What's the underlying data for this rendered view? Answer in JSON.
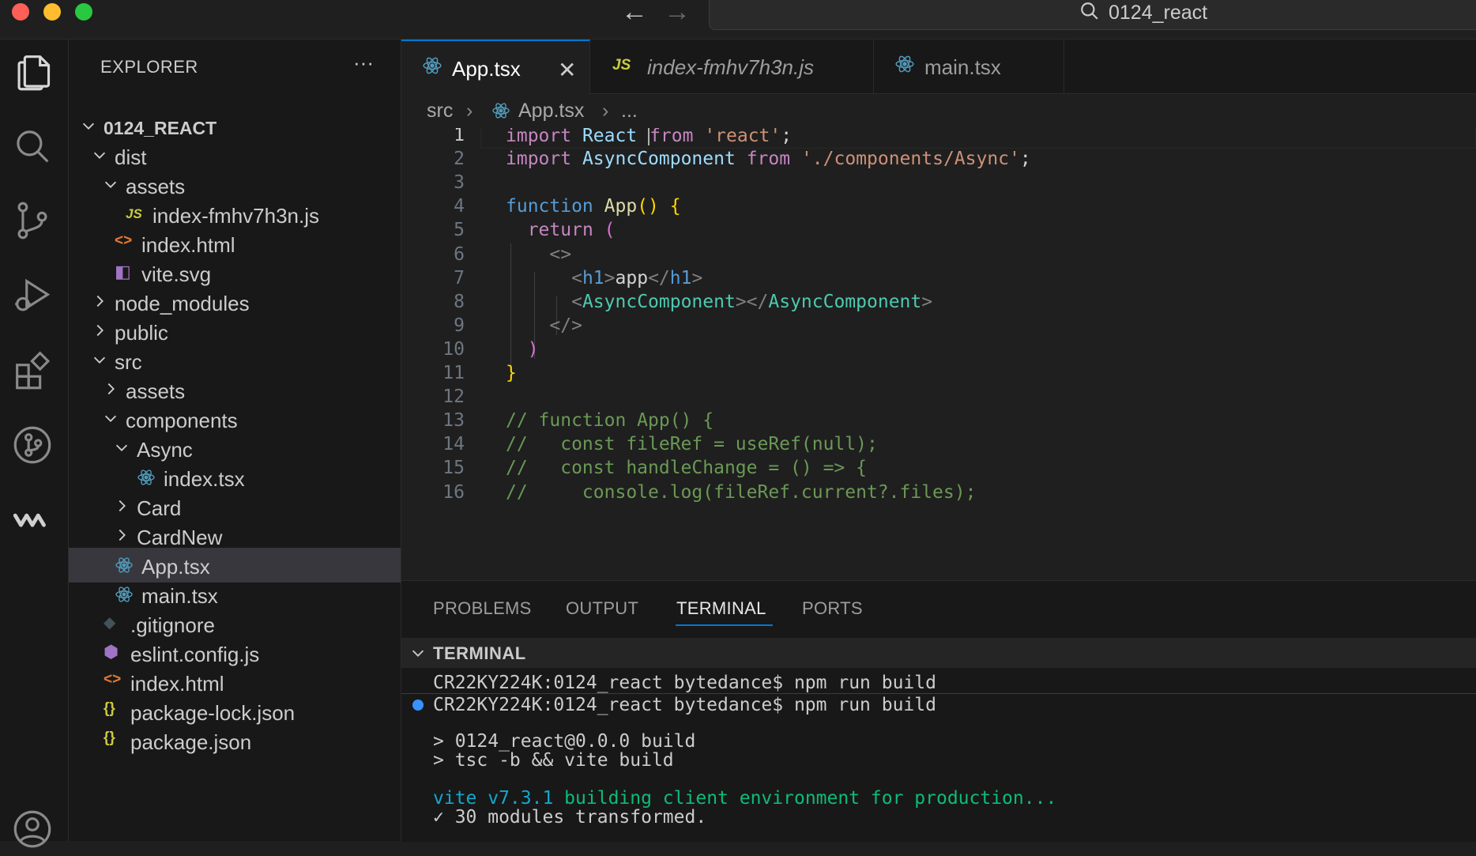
{
  "window": {
    "title": "0124_react"
  },
  "sidebar": {
    "title": "EXPLORER",
    "more": "···",
    "tree": [
      {
        "label": "0124_REACT",
        "type": "folder-open",
        "depth": 0,
        "bold": true
      },
      {
        "label": "dist",
        "type": "folder-open",
        "depth": 1
      },
      {
        "label": "assets",
        "type": "folder-open",
        "depth": 2
      },
      {
        "label": "index-fmhv7h3n.js",
        "type": "js",
        "depth": 3
      },
      {
        "label": "index.html",
        "type": "html",
        "depth": 2
      },
      {
        "label": "vite.svg",
        "type": "svg",
        "depth": 2
      },
      {
        "label": "node_modules",
        "type": "folder-closed",
        "depth": 1
      },
      {
        "label": "public",
        "type": "folder-closed",
        "depth": 1
      },
      {
        "label": "src",
        "type": "folder-open",
        "depth": 1
      },
      {
        "label": "assets",
        "type": "folder-closed",
        "depth": 2
      },
      {
        "label": "components",
        "type": "folder-open",
        "depth": 2
      },
      {
        "label": "Async",
        "type": "folder-open",
        "depth": 3
      },
      {
        "label": "index.tsx",
        "type": "react",
        "depth": 4
      },
      {
        "label": "Card",
        "type": "folder-closed",
        "depth": 3
      },
      {
        "label": "CardNew",
        "type": "folder-closed",
        "depth": 3
      },
      {
        "label": "App.tsx",
        "type": "react",
        "depth": 2,
        "selected": true
      },
      {
        "label": "main.tsx",
        "type": "react",
        "depth": 2
      },
      {
        "label": ".gitignore",
        "type": "git",
        "depth": 1
      },
      {
        "label": "eslint.config.js",
        "type": "eslint",
        "depth": 1
      },
      {
        "label": "index.html",
        "type": "html",
        "depth": 1
      },
      {
        "label": "package-lock.json",
        "type": "json",
        "depth": 1
      },
      {
        "label": "package.json",
        "type": "json",
        "depth": 1
      }
    ]
  },
  "tabs": [
    {
      "label": "App.tsx",
      "icon": "react",
      "active": true,
      "close": "✕"
    },
    {
      "label": "index-fmhv7h3n.js",
      "icon": "js",
      "italic": true
    },
    {
      "label": "main.tsx",
      "icon": "react"
    }
  ],
  "breadcrumb": {
    "folder": "src",
    "sep": "›",
    "file": "App.tsx",
    "more": "..."
  },
  "editor": {
    "active_line": 1,
    "lines": [
      {
        "n": "1",
        "tokens": [
          [
            "kw",
            "import"
          ],
          [
            "plain",
            " "
          ],
          [
            "id",
            "React"
          ],
          [
            "plain",
            " "
          ],
          [
            "cursor",
            ""
          ],
          [
            "kw",
            "from"
          ],
          [
            "plain",
            " "
          ],
          [
            "str",
            "'react'"
          ],
          [
            "plain",
            ";"
          ]
        ]
      },
      {
        "n": "2",
        "tokens": [
          [
            "kw",
            "import"
          ],
          [
            "plain",
            " "
          ],
          [
            "id",
            "AsyncComponent"
          ],
          [
            "plain",
            " "
          ],
          [
            "kw",
            "from"
          ],
          [
            "plain",
            " "
          ],
          [
            "str",
            "'./components/Async'"
          ],
          [
            "plain",
            ";"
          ]
        ]
      },
      {
        "n": "3",
        "tokens": []
      },
      {
        "n": "4",
        "tokens": [
          [
            "kw2",
            "function"
          ],
          [
            "plain",
            " "
          ],
          [
            "fn",
            "App"
          ],
          [
            "br1",
            "()"
          ],
          [
            "plain",
            " "
          ],
          [
            "br1",
            "{"
          ]
        ]
      },
      {
        "n": "5",
        "tokens": [
          [
            "plain",
            "  "
          ],
          [
            "kw",
            "return"
          ],
          [
            "plain",
            " "
          ],
          [
            "br2",
            "("
          ]
        ]
      },
      {
        "n": "6",
        "tokens": [
          [
            "plain",
            "    "
          ],
          [
            "tag",
            "<>"
          ]
        ]
      },
      {
        "n": "7",
        "tokens": [
          [
            "plain",
            "      "
          ],
          [
            "tag",
            "<"
          ],
          [
            "tname",
            "h1"
          ],
          [
            "tag",
            ">"
          ],
          [
            "plain",
            "app"
          ],
          [
            "tag",
            "</"
          ],
          [
            "tname",
            "h1"
          ],
          [
            "tag",
            ">"
          ]
        ]
      },
      {
        "n": "8",
        "tokens": [
          [
            "plain",
            "      "
          ],
          [
            "tag",
            "<"
          ],
          [
            "comp",
            "AsyncComponent"
          ],
          [
            "tag",
            "></"
          ],
          [
            "comp",
            "AsyncComponent"
          ],
          [
            "tag",
            ">"
          ]
        ]
      },
      {
        "n": "9",
        "tokens": [
          [
            "plain",
            "    "
          ],
          [
            "tag",
            "</>"
          ]
        ]
      },
      {
        "n": "10",
        "tokens": [
          [
            "plain",
            "  "
          ],
          [
            "br2",
            ")"
          ]
        ]
      },
      {
        "n": "11",
        "tokens": [
          [
            "br1",
            "}"
          ]
        ]
      },
      {
        "n": "12",
        "tokens": []
      },
      {
        "n": "13",
        "tokens": [
          [
            "cm",
            "// function App() {"
          ]
        ]
      },
      {
        "n": "14",
        "tokens": [
          [
            "cm",
            "//   const fileRef = useRef(null);"
          ]
        ]
      },
      {
        "n": "15",
        "tokens": [
          [
            "cm",
            "//   const handleChange = () => {"
          ]
        ]
      },
      {
        "n": "16",
        "tokens": [
          [
            "cm",
            "//     console.log(fileRef.current?.files);"
          ]
        ]
      }
    ]
  },
  "panel": {
    "tabs": [
      "PROBLEMS",
      "OUTPUT",
      "TERMINAL",
      "PORTS"
    ],
    "active_tab": "TERMINAL",
    "terminal_header": "TERMINAL",
    "terminal": {
      "line1": "CR22KY224K:0124_react bytedance$ npm run build",
      "line2": "CR22KY224K:0124_react bytedance$ npm run build",
      "line3": "> 0124_react@0.0.0 build",
      "line4": "> tsc -b && vite build",
      "line5_a": "vite v7.3.1",
      "line5_b": " building client environment for production...",
      "line6": "✓ 30 modules transformed."
    }
  },
  "colors": {
    "accent": "#0078d4",
    "background": "#1f1f1f",
    "sidebar": "#181818"
  }
}
